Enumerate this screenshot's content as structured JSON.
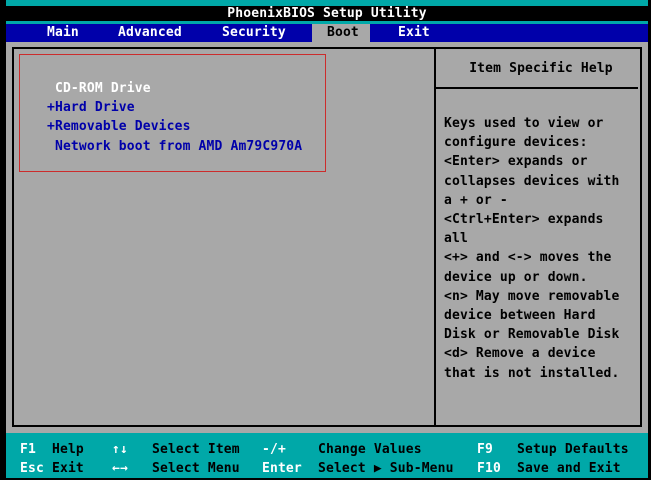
{
  "window": {
    "title": "PhoenixBIOS Setup Utility"
  },
  "menu": {
    "items": [
      {
        "label": "Main",
        "active": false
      },
      {
        "label": "Advanced",
        "active": false
      },
      {
        "label": "Security",
        "active": false
      },
      {
        "label": "Boot",
        "active": true
      },
      {
        "label": "Exit",
        "active": false
      }
    ]
  },
  "boot": {
    "items": [
      {
        "text": " CD-ROM Drive",
        "selected": true
      },
      {
        "text": "+Hard Drive",
        "selected": false
      },
      {
        "text": "+Removable Devices",
        "selected": false
      },
      {
        "text": " Network boot from AMD Am79C970A",
        "selected": false
      }
    ]
  },
  "help": {
    "title": "Item Specific Help",
    "body": "Keys used to view or\nconfigure devices:\n<Enter> expands or\ncollapses devices with\na + or -\n<Ctrl+Enter> expands\nall\n<+> and <-> moves the\ndevice up or down.\n<n> May move removable\ndevice between Hard\nDisk or Removable Disk\n<d> Remove a device\nthat is not installed."
  },
  "key_bar": {
    "rows": [
      {
        "cells": [
          {
            "key": "F1",
            "label": "Help"
          },
          {
            "key": "↑↓",
            "label": "Select Item"
          },
          {
            "key": "-/+",
            "label": "Change Values"
          },
          {
            "key": "F9",
            "label": "Setup Defaults"
          }
        ]
      },
      {
        "cells": [
          {
            "key": "Esc",
            "label": "Exit"
          },
          {
            "key": "←→",
            "label": "Select Menu"
          },
          {
            "key": "Enter",
            "label": "Select ▶ Sub-Menu"
          },
          {
            "key": "F10",
            "label": "Save and Exit"
          }
        ]
      }
    ]
  },
  "colors": {
    "teal": "#00A8A8",
    "blue": "#0000AA",
    "grey": "#A8A8A8",
    "red": "#CC2C2C",
    "black": "#000000",
    "white": "#FFFFFF"
  }
}
